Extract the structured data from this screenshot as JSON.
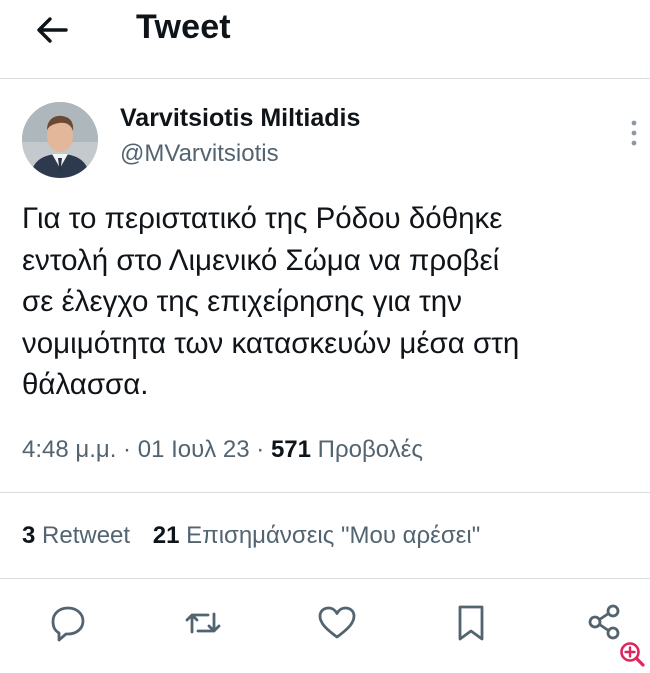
{
  "header": {
    "title": "Tweet"
  },
  "tweet": {
    "author_name": "Varvitsiotis Miltiadis",
    "author_handle": "@MVarvitsiotis",
    "text_lines": [
      "Για το περιστατικό της Ρόδου δόθηκε",
      "εντολή στο Λιμενικό Σώμα να προβεί",
      "σε έλεγχο της επιχείρησης για την",
      "νομιμότητα των κατασκευών μέσα στη",
      "θάλασσα."
    ],
    "time": "4:48 μ.μ.",
    "separator": "·",
    "date": "01 Ιουλ 23",
    "views_count": "571",
    "views_label": "Προβολές"
  },
  "stats": {
    "retweets_count": "3",
    "retweets_label": "Retweet",
    "likes_count": "21",
    "likes_label": "Επισημάνσεις \"Μου αρέσει\""
  },
  "icons": {
    "back": "back-arrow-icon",
    "more": "more-vertical-icon",
    "reply": "reply-icon",
    "retweet": "retweet-icon",
    "like": "heart-icon",
    "bookmark": "bookmark-icon",
    "share": "share-icon",
    "zoom": "zoom-in-icon"
  },
  "colors": {
    "text": "#0f1419",
    "secondary": "#536471",
    "divider": "#d9dde0",
    "zoom_badge": "#e0245e"
  }
}
